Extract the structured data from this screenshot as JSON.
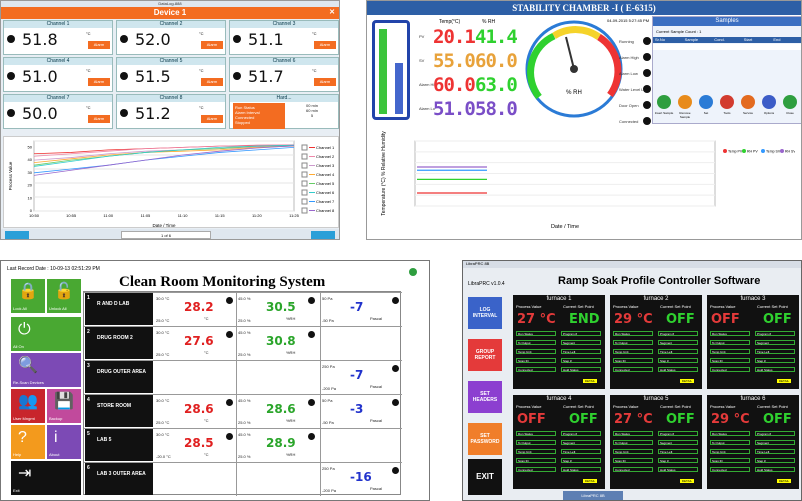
{
  "p1": {
    "title": "DataLog-888",
    "device": "Device 1",
    "channels": [
      {
        "name": "Channel 1",
        "value": "51.8",
        "unit": "°C",
        "alarm": "Alarm"
      },
      {
        "name": "Channel 2",
        "value": "52.0",
        "unit": "°C",
        "alarm": "Alarm"
      },
      {
        "name": "Channel 3",
        "value": "51.1",
        "unit": "°C",
        "alarm": "Alarm"
      },
      {
        "name": "Channel 4",
        "value": "51.0",
        "unit": "°C",
        "alarm": "Alarm"
      },
      {
        "name": "Channel 5",
        "value": "51.5",
        "unit": "°C",
        "alarm": "Alarm"
      },
      {
        "name": "Channel 6",
        "value": "51.7",
        "unit": "°C",
        "alarm": "Alarm"
      },
      {
        "name": "Channel 7",
        "value": "50.0",
        "unit": "°C",
        "alarm": "Alarm"
      },
      {
        "name": "Channel 8",
        "value": "51.2",
        "unit": "°C",
        "alarm": "Alarm"
      }
    ],
    "status_title": "Hard...",
    "status_lines": [
      "Run Status",
      "Alarm Interval",
      "Connected",
      "Stopped"
    ],
    "status_vals": [
      "00 min",
      "60 min",
      "5"
    ],
    "legend": [
      "Channel 1",
      "Channel 2",
      "Channel 3",
      "Channel 4",
      "Channel 5",
      "Channel 6",
      "Channel 7",
      "Channel 8"
    ],
    "ylabel": "Process Value",
    "xlabel": "Date / Time",
    "page": "1 of 6",
    "chart_data": {
      "type": "line",
      "title": "",
      "xlabel": "Date / Time",
      "ylabel": "Process Value",
      "ylim": [
        0,
        55
      ],
      "series": [
        {
          "name": "Channel 1",
          "values": [
            45,
            46,
            48,
            49,
            50,
            51,
            51.5,
            51.8
          ]
        },
        {
          "name": "Channel 2",
          "values": [
            43,
            45,
            47,
            49,
            50,
            51,
            51.8,
            52.0
          ]
        },
        {
          "name": "Channel 3",
          "values": [
            40,
            42,
            45,
            47,
            48,
            49,
            50.5,
            51.1
          ]
        },
        {
          "name": "Channel 4",
          "values": [
            38,
            41,
            44,
            46,
            47,
            48,
            50,
            51.0
          ]
        },
        {
          "name": "Channel 5",
          "values": [
            36,
            40,
            43,
            46,
            48,
            49,
            51,
            51.5
          ]
        },
        {
          "name": "Channel 6",
          "values": [
            35,
            39,
            43,
            46,
            48,
            50,
            51,
            51.7
          ]
        },
        {
          "name": "Channel 7",
          "values": [
            30,
            33,
            36,
            40,
            43,
            46,
            48,
            50.0
          ]
        },
        {
          "name": "Channel 8",
          "values": [
            28,
            32,
            36,
            40,
            44,
            47,
            49.5,
            51.2
          ]
        }
      ],
      "x": [
        "10:50",
        "10:55",
        "11:00",
        "11:05",
        "11:10",
        "11:15",
        "11:20",
        "11:25"
      ]
    }
  },
  "p2": {
    "title": "STABILITY CHAMBER -I ( E-6315)",
    "col_temp": "Temp(°C)",
    "col_rh": "% RH",
    "rows": [
      {
        "label": "PV",
        "temp": "20.1",
        "rh": "41.4"
      },
      {
        "label": "SV",
        "temp": "55.0",
        "rh": "60.0"
      },
      {
        "label": "Alarm Hi",
        "temp": "60.0",
        "rh": "63.0"
      },
      {
        "label": "Alarm Lo",
        "temp": "51.0",
        "rh": "58.0"
      }
    ],
    "gauge_unit": "% RH",
    "date": "04-09-2015 5:27:45 PM",
    "status": [
      "Running",
      "Alarm High",
      "Alarm Low",
      "Water Level Low",
      "Door Open",
      "Connected"
    ],
    "samples_title": "Samples",
    "samples_count": "Current Sample Count : 1",
    "sample_cols": [
      "Sr.No",
      "Sample",
      "Cond.",
      "Start",
      "End"
    ],
    "icons": [
      {
        "name": "Insert Sample",
        "color": "#2e9e3f"
      },
      {
        "name": "Remove Sample",
        "color": "#e88b1b"
      },
      {
        "name": "Set",
        "color": "#2b7bd6"
      },
      {
        "name": "Tools",
        "color": "#d23b2f"
      },
      {
        "name": "Service",
        "color": "#e36a1f"
      },
      {
        "name": "Options",
        "color": "#3c5cc7"
      },
      {
        "name": "Close",
        "color": "#2e9e3f"
      }
    ],
    "ylabel": "Temperature (°C) % Relative Humidity",
    "xlabel": "Date / Time",
    "legend": [
      "Temp PV",
      "RH PV",
      "Temp SV",
      "RH SV"
    ],
    "chart_data": {
      "type": "line",
      "title": "",
      "xlabel": "Date / Time",
      "ylabel": "Temperature (°C) % Relative Humidity",
      "ylim": [
        0,
        100
      ],
      "series": [
        {
          "name": "Temp PV",
          "values": [
            20,
            20,
            20,
            20,
            20,
            20
          ]
        },
        {
          "name": "RH PV",
          "values": [
            41,
            41,
            41,
            41,
            41,
            41
          ]
        },
        {
          "name": "Temp SV",
          "values": [
            55,
            55,
            55,
            55,
            55,
            55
          ]
        },
        {
          "name": "RH SV",
          "values": [
            60,
            60,
            60,
            60,
            60,
            60
          ]
        }
      ]
    }
  },
  "p3": {
    "last_record": "Last Record Date : 10-09-13 02:51:29 PM",
    "title": "Clean Room Monitoring System",
    "left_buttons": [
      {
        "label": "Lock All",
        "color": "#49a832",
        "icon": "🔒"
      },
      {
        "label": "Unlock All",
        "color": "#49a832",
        "icon": "🔓"
      },
      {
        "label": "All On",
        "color": "#49a832",
        "icon": "⏻"
      },
      {
        "label": "Re-Scan Devices",
        "color": "#7c4ab5",
        "icon": "🔍"
      },
      {
        "label": "User Mngmt",
        "color": "#c8252c",
        "icon": "👥"
      },
      {
        "label": "Backup",
        "color": "#c14a9c",
        "icon": "💾"
      },
      {
        "label": "Help",
        "color": "#f39a1d",
        "icon": "?"
      },
      {
        "label": "About",
        "color": "#7c4ab5",
        "icon": "i"
      },
      {
        "label": "Exit",
        "color": "#111",
        "icon": "⇥"
      }
    ],
    "rooms": [
      {
        "num": "1",
        "name": "R AND D LAB",
        "temp": "28.2",
        "temp_hi": "30.0 °C",
        "temp_lo": "25.0 °C",
        "rh": "30.5",
        "rh_hi": "45.0 %",
        "rh_lo": "25.0 %",
        "p": "-7",
        "p_hi": "50 Pa",
        "p_lo": "-50 Pa"
      },
      {
        "num": "2",
        "name": "DRUG ROOM 2",
        "temp": "27.6",
        "temp_hi": "30.0 °C",
        "temp_lo": "25.0 °C",
        "rh": "30.8",
        "rh_hi": "45.0 %",
        "rh_lo": "25.0 %",
        "p": "",
        "p_hi": "",
        "p_lo": ""
      },
      {
        "num": "3",
        "name": "DRUG OUTER AREA",
        "temp": "",
        "temp_hi": "",
        "temp_lo": "",
        "rh": "",
        "rh_hi": "",
        "rh_lo": "",
        "p": "-7",
        "p_hi": "250 Pa",
        "p_lo": "-200 Pa"
      },
      {
        "num": "4",
        "name": "STORE ROOM",
        "temp": "28.6",
        "temp_hi": "30.0 °C",
        "temp_lo": "25.0 °C",
        "rh": "28.6",
        "rh_hi": "45.0 %",
        "rh_lo": "25.0 %",
        "p": "-3",
        "p_hi": "50 Pa",
        "p_lo": "-50 Pa"
      },
      {
        "num": "5",
        "name": "LAB 5",
        "temp": "28.5",
        "temp_hi": "30.0 °C",
        "temp_lo": "-20.0 °C",
        "rh": "28.9",
        "rh_hi": "45.0 %",
        "rh_lo": "25.0 %",
        "p": "",
        "p_hi": "",
        "p_lo": ""
      },
      {
        "num": "6",
        "name": "LAB 3 OUTER AREA",
        "temp": "",
        "temp_hi": "",
        "temp_lo": "",
        "rh": "",
        "rh_hi": "",
        "rh_lo": "",
        "p": "-16",
        "p_hi": "250 Pa",
        "p_lo": "-200 Pa"
      }
    ],
    "unit_c": "°C",
    "unit_rh": "%RH",
    "unit_p": "Pascal"
  },
  "p4": {
    "window_title": "LibraPRC 8B",
    "version": "LibraPRC v1.0.4",
    "title": "Ramp Soak Profile Controller Software",
    "side_buttons": [
      {
        "label": "LOG INTERVAL",
        "color": "#3a63c9"
      },
      {
        "label": "GROUP REPORT",
        "color": "#e43a3a"
      },
      {
        "label": "SET HEADERS",
        "color": "#8c3fd0"
      },
      {
        "label": "SET PASSWORD",
        "color": "#f07e2a"
      },
      {
        "label": "EXIT",
        "color": "#111"
      }
    ],
    "h_pv": "Process Value",
    "h_sp": "Current Set Point",
    "furnaces": [
      {
        "name": "furnace 1",
        "pv": "27 °C",
        "pv_color": "#e43a3a",
        "sp": "END",
        "sp_color": "#2fd12f"
      },
      {
        "name": "furnace 2",
        "pv": "29 °C",
        "pv_color": "#e43a3a",
        "sp": "OFF",
        "sp_color": "#2fd12f"
      },
      {
        "name": "furnace 3",
        "pv": "OFF",
        "pv_color": "#e43a3a",
        "sp": "OFF",
        "sp_color": "#2fd12f"
      },
      {
        "name": "furnace 4",
        "pv": "OFF",
        "pv_color": "#e43a3a",
        "sp": "OFF",
        "sp_color": "#2fd12f"
      },
      {
        "name": "furnace 5",
        "pv": "27 °C",
        "pv_color": "#e43a3a",
        "sp": "OFF",
        "sp_color": "#2fd12f"
      },
      {
        "name": "furnace 6",
        "pv": "29 °C",
        "pv_color": "#e43a3a",
        "sp": "OFF",
        "sp_color": "#2fd12f"
      }
    ],
    "rows_left": [
      "Run Status",
      "% Output",
      "Temp Unit",
      "Scan ID",
      "Connected"
    ],
    "rows_right": [
      "Program #",
      "Segment",
      "Time Left",
      "Step #",
      "Hold Status"
    ],
    "detail_btn": "DETAIL",
    "taskbar": "LibraPRC 8B"
  }
}
